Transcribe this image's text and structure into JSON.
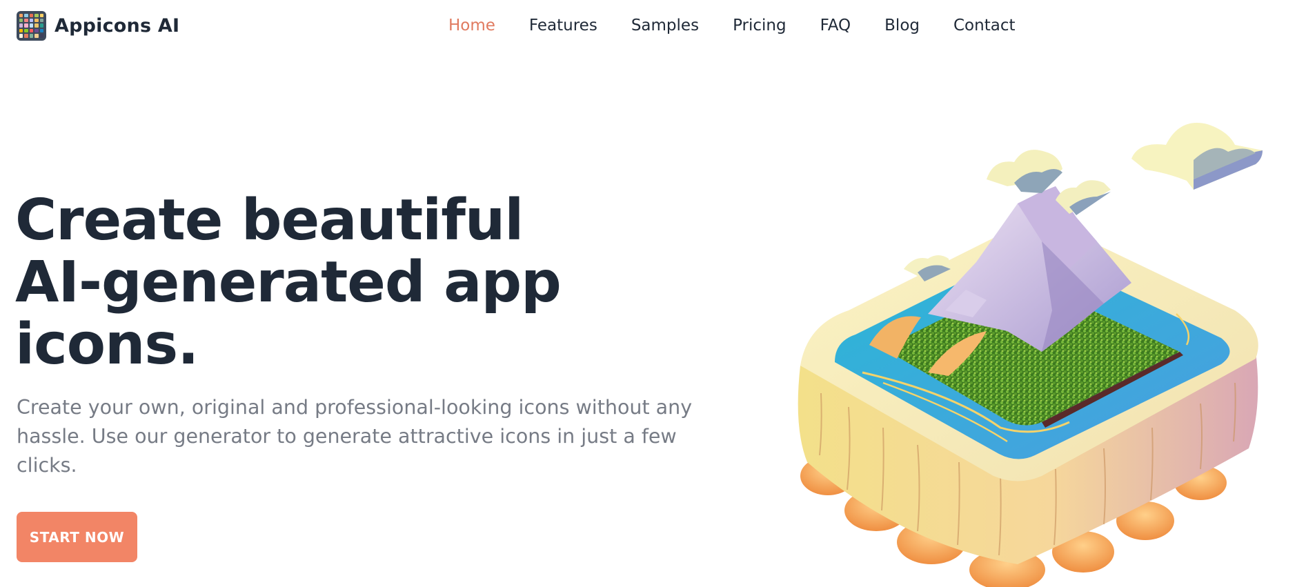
{
  "header": {
    "brand_name": "Appicons AI",
    "nav": [
      {
        "label": "Home",
        "active": true
      },
      {
        "label": "Features",
        "active": false
      },
      {
        "label": "Samples",
        "active": false
      },
      {
        "label": "Pricing",
        "active": false
      },
      {
        "label": "FAQ",
        "active": false
      },
      {
        "label": "Blog",
        "active": false
      },
      {
        "label": "Contact",
        "active": false
      }
    ]
  },
  "hero": {
    "title_line1": "Create beautiful",
    "title_line2": "AI-generated app",
    "title_line3": "icons.",
    "subtitle": "Create your own, original and professional-looking icons without any hassle. Use our generator to generate attractive icons in just a few clicks.",
    "cta_label": "START NOW"
  },
  "colors": {
    "accent": "#e07a5f",
    "cta": "#f28566",
    "heading": "#1f2937",
    "subtext": "#767b85"
  }
}
